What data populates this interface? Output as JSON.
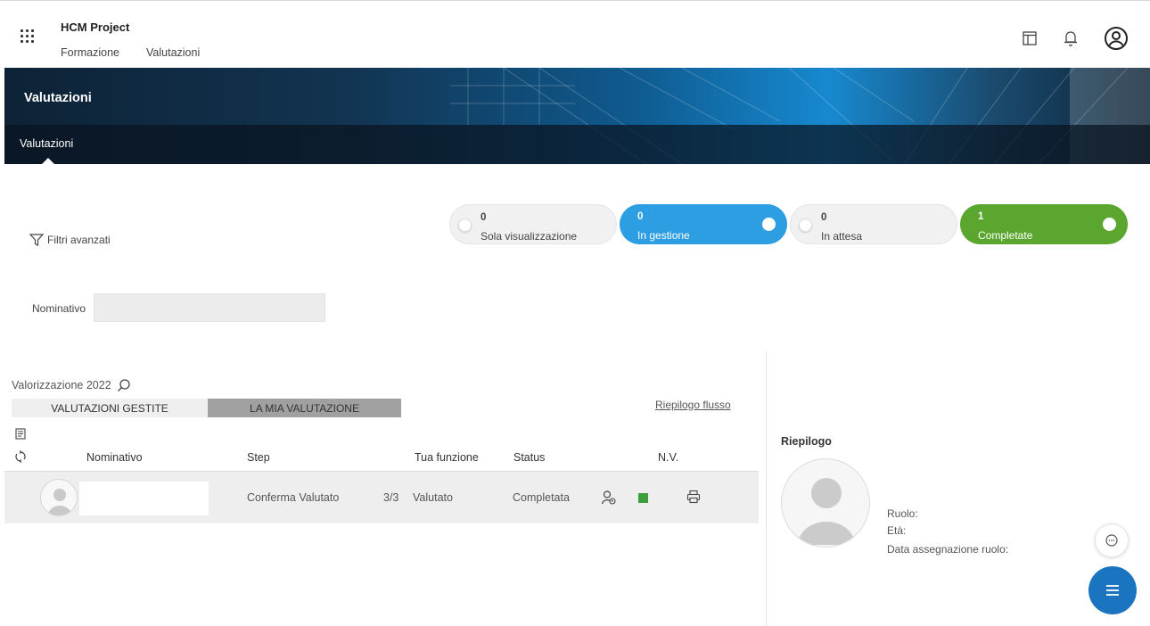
{
  "app": {
    "title": "HCM Project"
  },
  "topnav": {
    "items": [
      "Formazione",
      "Valutazioni"
    ]
  },
  "icons": {
    "apps": "apps-grid-icon",
    "panel": "panel-layout-icon",
    "notifications": "bell-icon",
    "account": "user-account-icon"
  },
  "banner": {
    "title": "Valutazioni",
    "tab": "Valutazioni"
  },
  "filters": {
    "advanced_label": "Filtri avanzati",
    "nominativo_label": "Nominativo",
    "nominativo_value": ""
  },
  "status_pills": [
    {
      "count": "0",
      "label": "Sola visualizzazione",
      "color": "#f1f1f1"
    },
    {
      "count": "0",
      "label": "In gestione",
      "color": "#2d9ee2"
    },
    {
      "count": "0",
      "label": "In attesa",
      "color": "#f1f1f1"
    },
    {
      "count": "1",
      "label": "Completate",
      "color": "#5ba62f"
    }
  ],
  "evaluation": {
    "label": "Valorizzazione 2022",
    "tabs": [
      "VALUTAZIONI GESTITE",
      "LA MIA VALUTAZIONE"
    ],
    "flow_link": "Riepilogo flusso"
  },
  "table": {
    "headers": [
      "Nominativo",
      "Step",
      "Tua funzione",
      "Status",
      "N.V."
    ],
    "rows": [
      {
        "nominativo": "",
        "step": "Conferma Valutato",
        "step_count": "3/3",
        "funzione": "Valutato",
        "status": "Completata",
        "nv_color": "#3c9f3c"
      }
    ]
  },
  "summary": {
    "title": "Riepilogo",
    "fields": [
      "Ruolo:",
      "Età:",
      "Data assegnazione ruolo:"
    ]
  }
}
